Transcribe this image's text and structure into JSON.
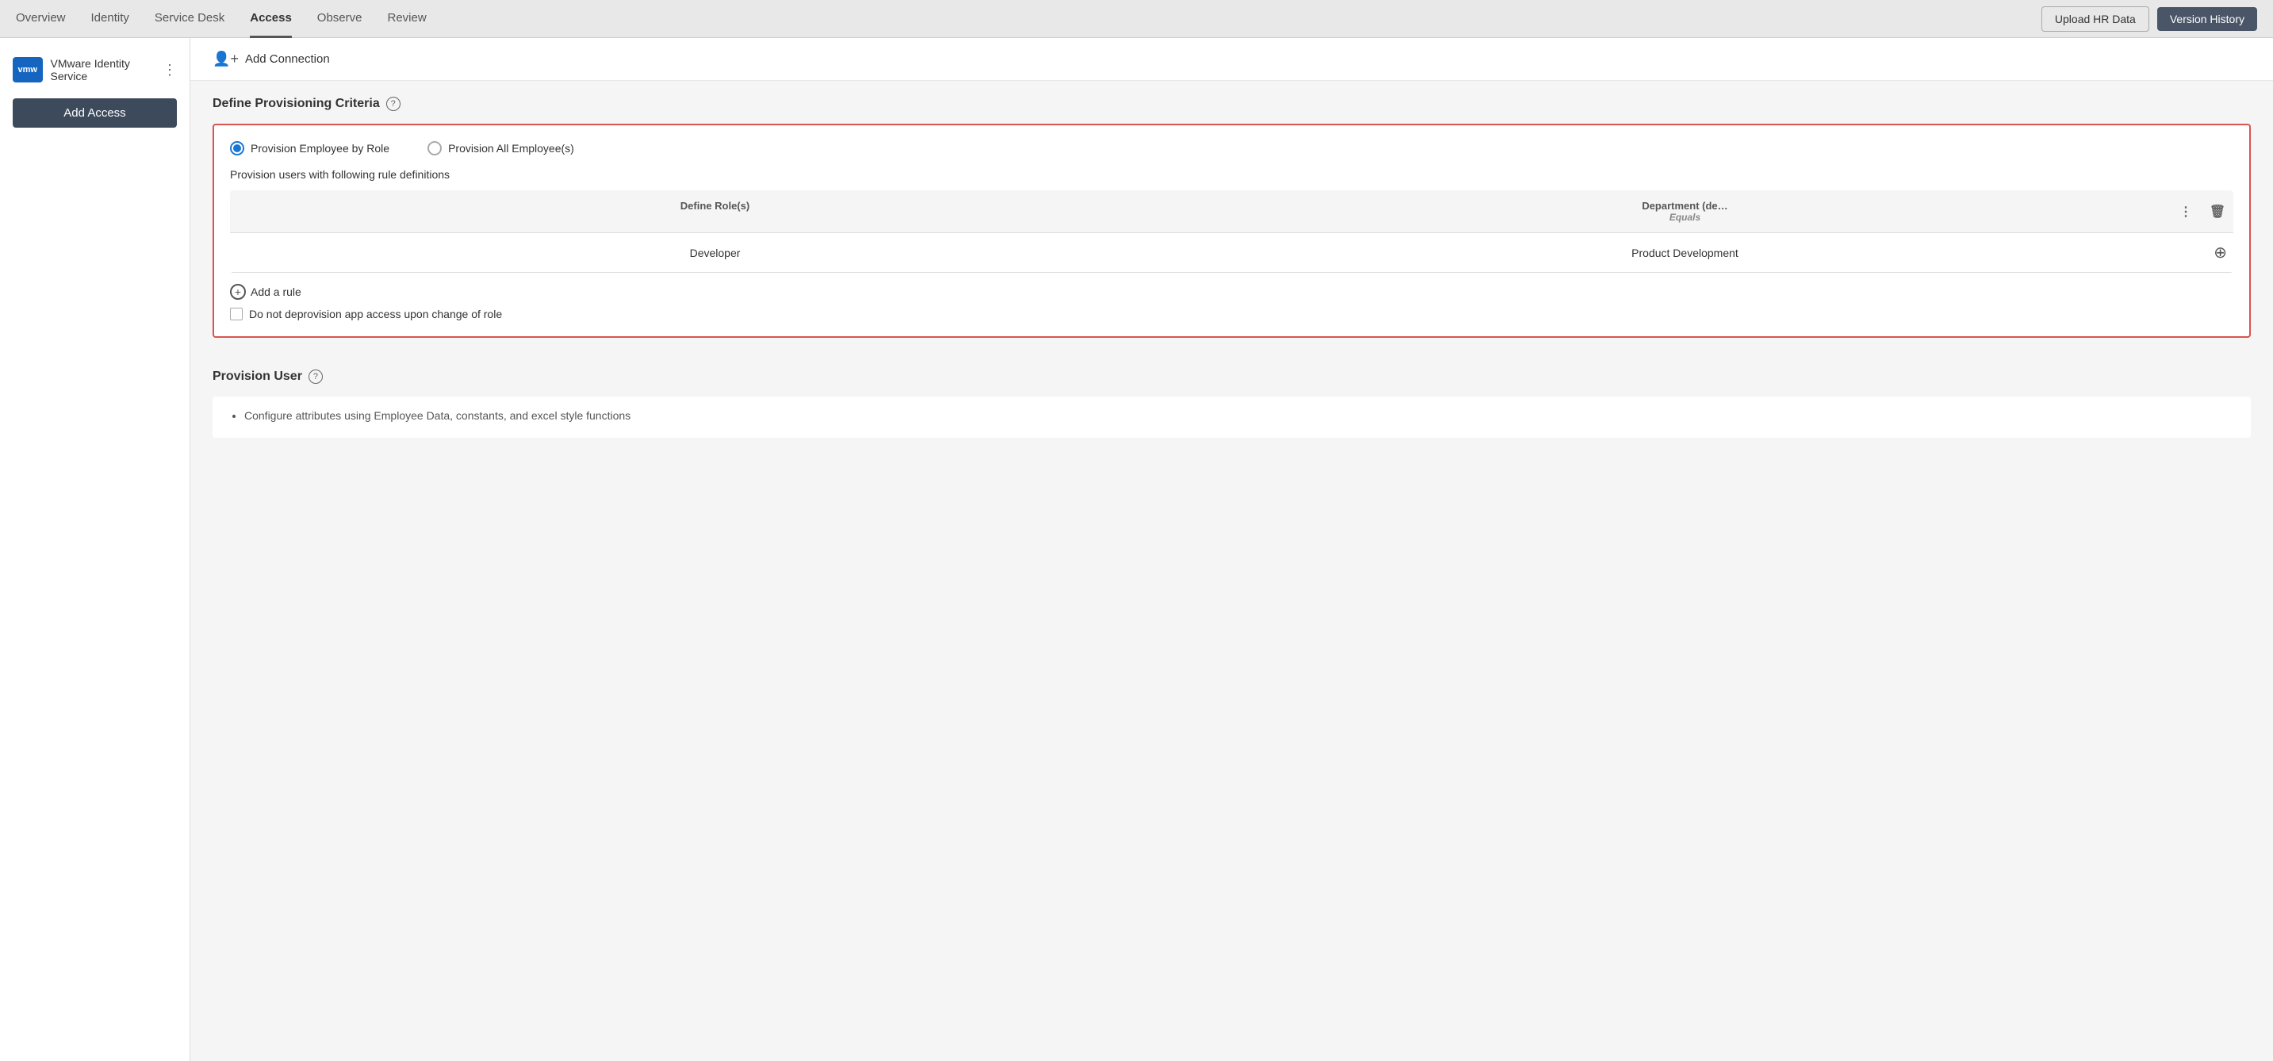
{
  "topNav": {
    "items": [
      {
        "label": "Overview",
        "active": false
      },
      {
        "label": "Identity",
        "active": false
      },
      {
        "label": "Service Desk",
        "active": false
      },
      {
        "label": "Access",
        "active": true
      },
      {
        "label": "Observe",
        "active": false
      },
      {
        "label": "Review",
        "active": false
      }
    ],
    "uploadHrData": "Upload HR Data",
    "versionHistory": "Version History"
  },
  "sidebar": {
    "logo": "vmw",
    "brandName": "VMware Identity Service",
    "addAccessLabel": "Add Access"
  },
  "addConnection": {
    "label": "Add Connection"
  },
  "criteriaSection": {
    "title": "Define Provisioning Criteria",
    "helpTooltip": "?",
    "radioOptions": [
      {
        "label": "Provision Employee by Role",
        "selected": true
      },
      {
        "label": "Provision All Employee(s)",
        "selected": false
      }
    ],
    "descText": "Provision users with following rule definitions",
    "table": {
      "col1Header": "Define Role(s)",
      "col2Header": "Department (de…",
      "col2Sub": "Equals",
      "moreIcon": "⋮",
      "deleteIcon": "🗑",
      "rows": [
        {
          "col1": "Developer",
          "col2": "Product Development"
        }
      ]
    },
    "addRuleLabel": "Add a rule",
    "checkboxLabel": "Do not deprovision app access upon change of role"
  },
  "provisionUser": {
    "title": "Provision User",
    "helpTooltip": "?",
    "bulletText": "Configure attributes using Employee Data, constants, and excel style functions"
  }
}
